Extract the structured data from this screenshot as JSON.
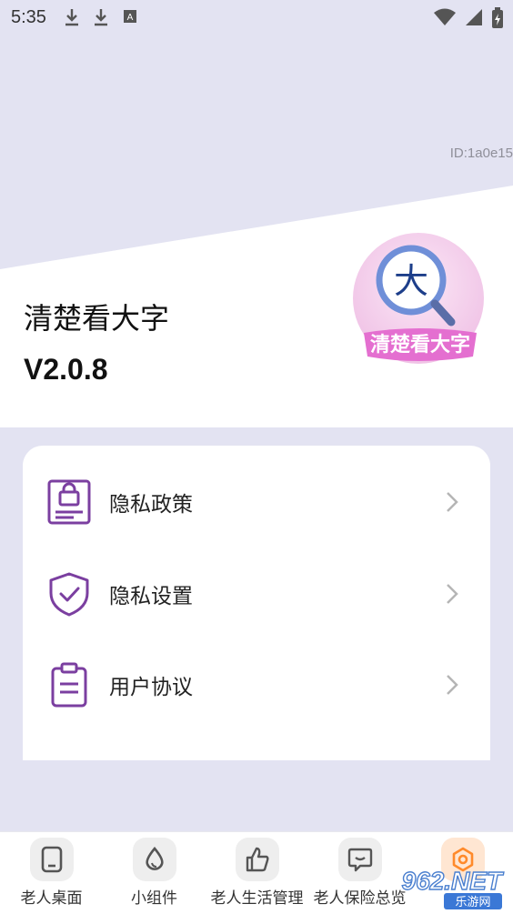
{
  "status_bar": {
    "time": "5:35",
    "left_icons": [
      "download-icon",
      "download-icon",
      "a-badge-icon"
    ],
    "right_icons": [
      "wifi-icon",
      "signal-icon",
      "battery-icon"
    ]
  },
  "id_label": "ID:1a0e15",
  "app": {
    "name": "清楚看大字",
    "version": "V2.0.8",
    "logo_glyph": "大",
    "logo_banner": "清楚看大字"
  },
  "menu": {
    "items": [
      {
        "label": "隐私政策",
        "icon": "lock-document-icon"
      },
      {
        "label": "隐私设置",
        "icon": "shield-check-icon"
      },
      {
        "label": "用户协议",
        "icon": "clipboard-icon"
      }
    ]
  },
  "tabs": [
    {
      "label": "老人桌面",
      "icon": "phone-icon"
    },
    {
      "label": "小组件",
      "icon": "drop-icon"
    },
    {
      "label": "老人生活管理",
      "icon": "thumb-up-icon"
    },
    {
      "label": "老人保险总览",
      "icon": "chat-smile-icon"
    },
    {
      "label": "",
      "icon": "settings-hex-icon",
      "active": true
    }
  ],
  "watermark": {
    "text": "962.NET",
    "sub": "乐游网"
  },
  "colors": {
    "accent_purple": "#7b3fa0",
    "background": "#e3e3f2",
    "active_tab": "#ff8a2b"
  }
}
